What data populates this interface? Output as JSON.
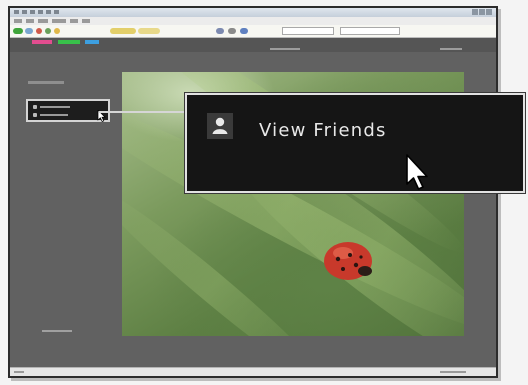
{
  "callout": {
    "label": "View Friends",
    "icon": "person-icon"
  },
  "colors": {
    "app_background": "#616161",
    "callout_background": "#151515",
    "callout_border": "#e2e2e2",
    "tab_pink": "#e24d8f",
    "tab_green": "#38c14a",
    "tab_blue": "#3d9fe0",
    "ladybug_red": "#c8392b"
  },
  "icons": [
    "person-icon",
    "mouse-pointer-icon",
    "ladybug-photo"
  ]
}
